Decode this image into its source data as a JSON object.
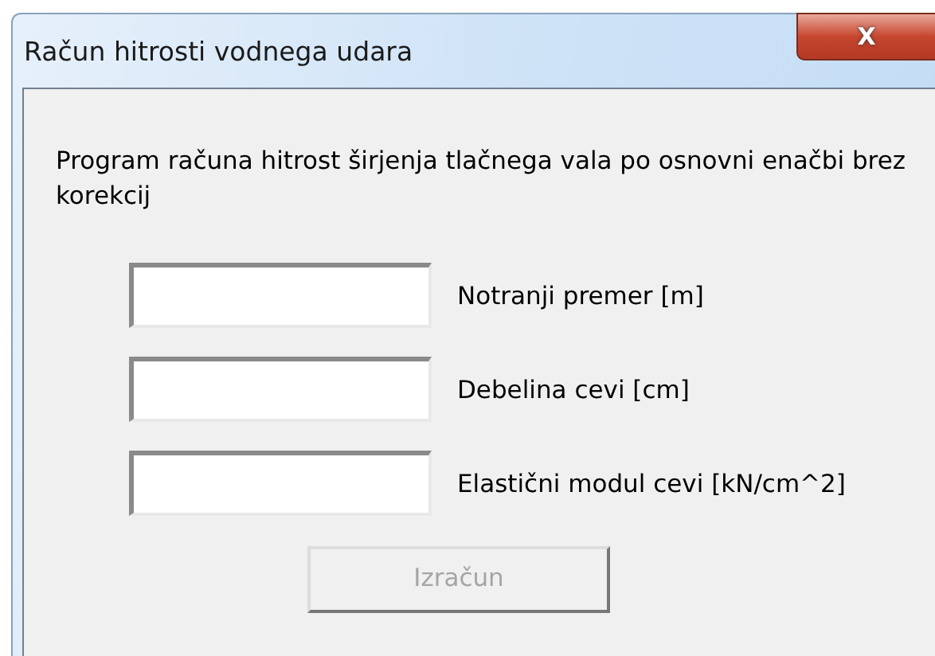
{
  "window": {
    "title": "Račun hitrosti vodnega udara",
    "close": "X"
  },
  "description": "Program računa hitrost širjenja tlačnega vala po osnovni enačbi brez korekcij",
  "fields": [
    {
      "label": "Notranji premer [m]"
    },
    {
      "label": "Debelina cevi [cm]"
    },
    {
      "label": "Elastični modul cevi [kN/cm^2]"
    }
  ],
  "button": {
    "label": "Izračun",
    "disabled": true
  }
}
